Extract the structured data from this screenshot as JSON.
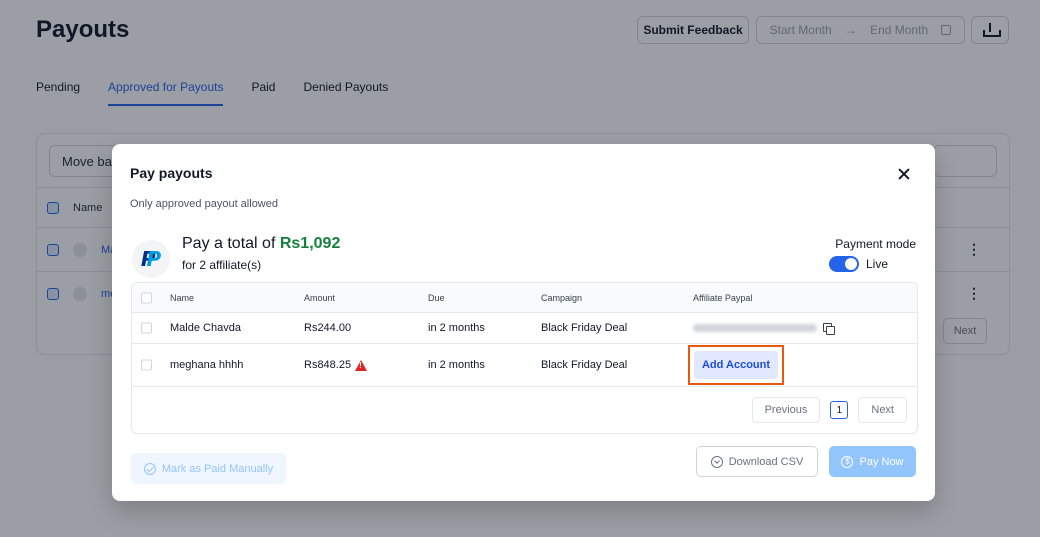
{
  "page": {
    "title": "Payouts",
    "header": {
      "feedback_label": "Submit Feedback",
      "start_month_placeholder": "Start Month",
      "range_arrow": "→",
      "end_month_placeholder": "End Month"
    },
    "tabs": [
      {
        "label": "Pending",
        "active": false
      },
      {
        "label": "Approved for Payouts",
        "active": true
      },
      {
        "label": "Paid",
        "active": false
      },
      {
        "label": "Denied Payouts",
        "active": false
      }
    ],
    "background_table": {
      "move_back_label": "Move bac",
      "header_name": "Name",
      "rows": [
        "Ma",
        "me"
      ],
      "kebab": "⋮",
      "next_label": "Next"
    }
  },
  "modal": {
    "title": "Pay payouts",
    "subtitle": "Only approved payout allowed",
    "total_prefix": "Pay a total of ",
    "total_amount": "Rs1,092",
    "affiliates_text": "for 2 affiliate(s)",
    "payment_mode_label": "Payment mode",
    "payment_mode_value": "Live",
    "table": {
      "headers": [
        "Name",
        "Amount",
        "Due",
        "Campaign",
        "Affiliate Paypal"
      ],
      "rows": [
        {
          "name": "Malde Chavda",
          "amount": "Rs244.00",
          "due": "in 2 months",
          "campaign": "Black Friday Deal",
          "paypal_status": "masked"
        },
        {
          "name": "meghana hhhh",
          "amount": "Rs848.25",
          "due": "in 2 months",
          "campaign": "Black Friday Deal",
          "paypal_status": "missing"
        }
      ],
      "add_account_label": "Add Account",
      "pagination": {
        "previous_label": "Previous",
        "current_page": "1",
        "next_label": "Next"
      }
    },
    "mark_paid_label": "Mark as Paid Manually",
    "download_csv_label": "Download CSV",
    "pay_now_label": "Pay Now"
  },
  "colors": {
    "accent": "#2563eb",
    "total_amount": "#15803d",
    "warning": "#dc2626",
    "highlight": "#ea580c"
  },
  "icons": [
    "close-icon",
    "paypal-icon",
    "copy-icon",
    "warning-icon",
    "check-circle-icon",
    "download-icon",
    "dollar-icon",
    "calendar-icon"
  ]
}
